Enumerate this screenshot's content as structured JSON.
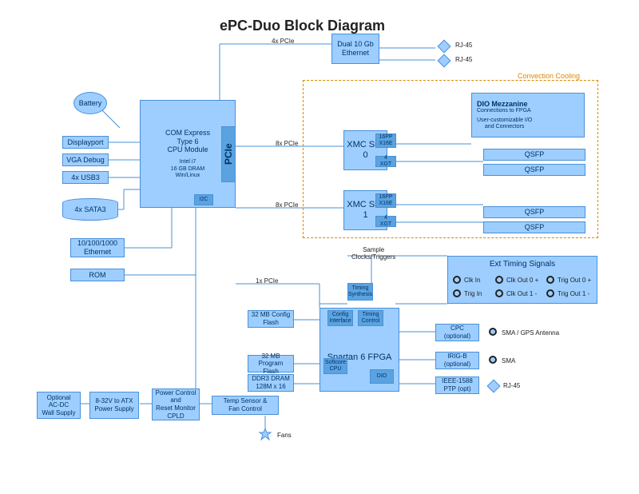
{
  "title": "ePC-Duo Block Diagram",
  "ethernet": {
    "label": "Dual 10 Gb\nEthernet",
    "bus": "4x PCIe",
    "port": "RJ-45"
  },
  "cpu": {
    "label": "COM Express\nType 6\nCPU Module",
    "sub": "Intel i7\n16 GB DRAM\nWin/Linux"
  },
  "pcie": "PCIe",
  "peripherals": {
    "battery": "Battery",
    "dp": "Displayport",
    "vga": "VGA Debug",
    "usb": "4x USB3",
    "sata": "4x SATA3",
    "eth": "10/100/1000\nEthernet",
    "rom": "ROM",
    "i2c": "I2C"
  },
  "bus": {
    "x8": "8x PCIe",
    "x1": "1x PCIe"
  },
  "xmc": {
    "site0": "XMC\nSite 0",
    "site1": "XMC\nSite 1",
    "x16": "16PP\nX16E",
    "x4": "4 XGT"
  },
  "mezz": {
    "title": "DIO Mezzanine",
    "sub": "Connections to FPGA",
    "desc": "User-customizable I/O\nand Connectors"
  },
  "qsfp": "QSFP",
  "cooling": "Convection Cooling",
  "fpga": {
    "label": "Spartan 6\nFPGA",
    "timsyn": "Timing\nSynthesis",
    "cfgif": "Config\nInterface",
    "timctl": "Timing\nControl",
    "softcore": "Softcore\nCPU",
    "dio": "DIO",
    "cfgflash": "32 MB Config\nFlash",
    "progflash": "32 MB\nProgram Flash",
    "dram": "DDR3 DRAM\n128M x 16",
    "sample": "Sample\nClocks/Triggers"
  },
  "ext": {
    "title": "Ext Timing Signals",
    "clkin": "Clk In",
    "trigin": "Trig In",
    "clkout0p": "Clk Out 0 +",
    "clkout1m": "Clk Out 1 -",
    "trigout0p": "Trig Out 0 +",
    "trigout1m": "Trig Out 1 -"
  },
  "gps": {
    "cpc": "CPC\n(optional)",
    "irig": "IRIG-B\n(optional)",
    "ptp": "IEEE-1588\nPTP (opt)",
    "smagps": "SMA / GPS Antenna",
    "sma": "SMA",
    "rj45": "RJ-45"
  },
  "power": {
    "wall": "Optional\nAC-DC\nWall Supply",
    "atx": "8-32V to ATX\nPower Supply",
    "ctrl": "Power Control\nand\nReset Monitor\nCPLD",
    "temp": "Temp Sensor &\nFan Control",
    "fans": "Fans"
  }
}
